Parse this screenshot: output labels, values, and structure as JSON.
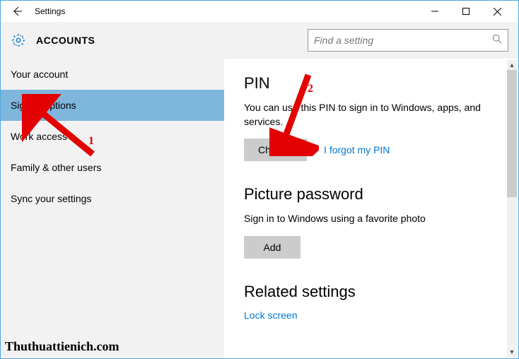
{
  "titlebar": {
    "title": "Settings"
  },
  "header": {
    "title": "ACCOUNTS",
    "search_placeholder": "Find a setting"
  },
  "sidebar": {
    "items": [
      {
        "label": "Your account",
        "active": false
      },
      {
        "label": "Sign-in options",
        "active": true
      },
      {
        "label": "Work access",
        "active": false
      },
      {
        "label": "Family & other users",
        "active": false
      },
      {
        "label": "Sync your settings",
        "active": false
      }
    ]
  },
  "main": {
    "pin": {
      "title": "PIN",
      "desc": "You can use this PIN to sign in to Windows, apps, and services.",
      "change_btn": "Change",
      "forgot_link": "I forgot my PIN"
    },
    "picture": {
      "title": "Picture password",
      "desc": "Sign in to Windows using a favorite photo",
      "add_btn": "Add"
    },
    "related": {
      "title": "Related settings",
      "lock_link": "Lock screen"
    }
  },
  "annotations": {
    "num1": "1",
    "num2": "2"
  },
  "watermark": "Thuthuattienich.com"
}
